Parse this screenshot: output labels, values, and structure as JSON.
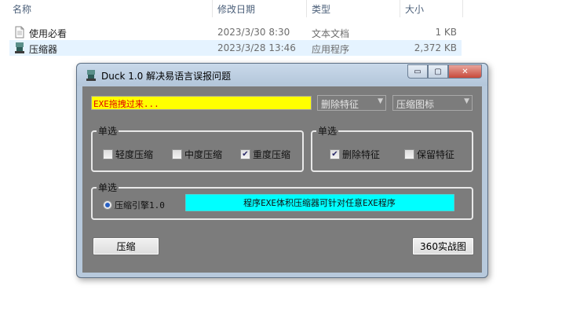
{
  "explorer": {
    "columns": {
      "name": "名称",
      "modified": "修改日期",
      "type": "类型",
      "size": "大小"
    },
    "files": [
      {
        "name": "使用必看",
        "modified": "2023/3/30 8:30",
        "type": "文本文档",
        "size": "1 KB",
        "icon": "text-document-icon"
      },
      {
        "name": "压缩器",
        "modified": "2023/3/28 13:46",
        "type": "应用程序",
        "size": "2,372 KB",
        "icon": "duck-app-icon"
      }
    ]
  },
  "dialog": {
    "title": "Duck 1.0 解决易语言误报问题",
    "window_buttons": {
      "minimize": "▭",
      "maximize": "▢",
      "close": "✕"
    },
    "drop_field_text": "EXE拖拽过来...",
    "combo_remove": {
      "value": "删除特征"
    },
    "combo_icon": {
      "value": "压缩图标"
    },
    "group_compress": {
      "label": "单选",
      "options": [
        {
          "label": "轻度压缩",
          "checked": false
        },
        {
          "label": "中度压缩",
          "checked": false
        },
        {
          "label": "重度压缩",
          "checked": true
        }
      ]
    },
    "group_feature": {
      "label": "单选",
      "options": [
        {
          "label": "删除特征",
          "checked": true
        },
        {
          "label": "保留特征",
          "checked": false
        }
      ]
    },
    "group_engine": {
      "label": "单选",
      "radio_label": "压缩引擎1.0",
      "radio_selected": true
    },
    "info_banner": "程序EXE体积压缩器可针对任意EXE程序",
    "buttons": {
      "compress": "压缩",
      "screenshot": "360实战图"
    },
    "colors": {
      "client_bg": "#7c7c7c",
      "drop_field_bg": "#ffff00",
      "drop_field_text": "#e00000",
      "info_banner_bg": "#00ffff"
    }
  }
}
